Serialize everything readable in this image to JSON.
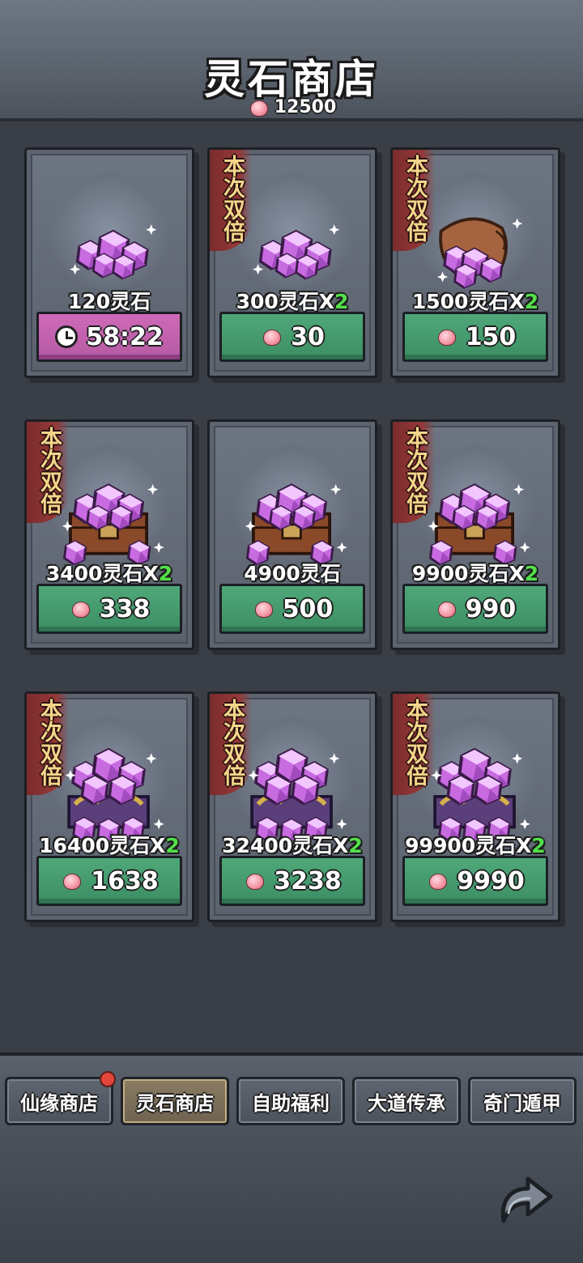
{
  "header": {
    "title": "灵石商店",
    "currency_amount": "12500",
    "currency_icon": "peach-icon"
  },
  "badge_text": "本次双倍",
  "items": [
    {
      "amount": "120灵石",
      "mult": "",
      "price": "58:22",
      "kind": "timer",
      "icon": "gem-pile",
      "double": false
    },
    {
      "amount": "300灵石X",
      "mult": "2",
      "price": "30",
      "kind": "buy",
      "icon": "gem-pile",
      "double": true
    },
    {
      "amount": "1500灵石X",
      "mult": "2",
      "price": "150",
      "kind": "buy",
      "icon": "gem-bag",
      "double": true
    },
    {
      "amount": "3400灵石X",
      "mult": "2",
      "price": "338",
      "kind": "buy",
      "icon": "gem-crate",
      "double": true
    },
    {
      "amount": "4900灵石",
      "mult": "",
      "price": "500",
      "kind": "buy",
      "icon": "gem-crate",
      "double": false
    },
    {
      "amount": "9900灵石X",
      "mult": "2",
      "price": "990",
      "kind": "buy",
      "icon": "gem-crate",
      "double": true
    },
    {
      "amount": "16400灵石X",
      "mult": "2",
      "price": "1638",
      "kind": "buy",
      "icon": "gem-chest",
      "double": true
    },
    {
      "amount": "32400灵石X",
      "mult": "2",
      "price": "3238",
      "kind": "buy",
      "icon": "gem-chest",
      "double": true
    },
    {
      "amount": "99900灵石X",
      "mult": "2",
      "price": "9990",
      "kind": "buy",
      "icon": "gem-chest",
      "double": true
    }
  ],
  "tabs": [
    {
      "label": "仙缘商店",
      "active": false,
      "notify": true
    },
    {
      "label": "灵石商店",
      "active": true,
      "notify": false
    },
    {
      "label": "自助福利",
      "active": false,
      "notify": false
    },
    {
      "label": "大道传承",
      "active": false,
      "notify": false
    },
    {
      "label": "奇门遁甲",
      "active": false,
      "notify": false
    }
  ],
  "colors": {
    "buy_button": "#4fa87a",
    "timer_button": "#cf6ab8",
    "multiplier": "#52e04a",
    "badge_ribbon": "#953838",
    "badge_text": "#f3d58a"
  }
}
